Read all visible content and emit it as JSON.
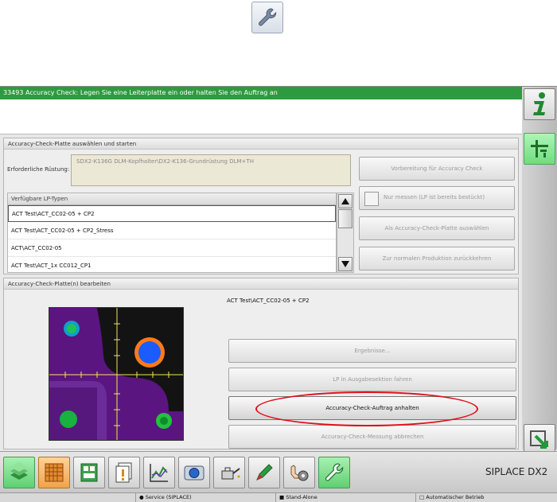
{
  "title_bar": {
    "message": "33493 Accuracy Check: Legen Sie eine Leiterplatte ein oder halten Sie den Auftrag an"
  },
  "panel_select": {
    "title": "Accuracy-Check-Platte auswählen und starten",
    "required_setup_label": "Erforderliche Rüstung:",
    "required_setup_value": "SDX2-K136G DLM-Kopfhalter\\DX2-K136-Grundrüstung DLM+TH",
    "list_header": "Verfügbare LP-Typen",
    "list_items": [
      "ACT Test\\ACT_CC02-05 + CP2",
      "ACT Test\\ACT_CC02-05 + CP2_Stress",
      "ACT\\ACT_CC02-05",
      "ACT Test\\ACT_1x CC012_CP1"
    ],
    "prepare_button": "Vorbereitung für Accuracy Check",
    "measure_only_label": "Nur messen (LP ist bereits bestückt)",
    "select_plate_button": "Als Accuracy-Check-Platte auswählen",
    "back_to_production_button": "Zur normalen Produktion zurückkehren"
  },
  "panel_edit": {
    "title": "Accuracy-Check-Platte(n) bearbeiten",
    "plate_name": "ACT Test\\ACT_CC02-05 + CP2",
    "results_button": "Ergebnisse...",
    "pcb_out_button": "LP in Ausgabesektion fahren",
    "stop_job_button": "Accuracy-Check-Auftrag anhalten",
    "abort_button": "Accuracy-Check-Messung abbrechen"
  },
  "toolbar": {
    "brand": "SIPLACE DX2"
  },
  "status_bar": {
    "service": "Service (SIPLACE)",
    "stand_alone": "Stand-Alone",
    "mode": "Automatischer Betrieb"
  },
  "colors": {
    "title_green": "#2e9a3f",
    "highlight_red": "#e0101a",
    "active_green": "#5fcf72"
  },
  "icons": {
    "top": "wrench-icon",
    "right_bar": [
      "info-icon",
      "layout-icon",
      "exit-arrow-icon"
    ],
    "toolbar": [
      "stack-icon",
      "grid-icon",
      "board-icon",
      "report-icon",
      "chart-icon",
      "camera-icon",
      "oil-can-icon",
      "pen-icon",
      "hand-gear-icon",
      "wrench-icon"
    ]
  }
}
